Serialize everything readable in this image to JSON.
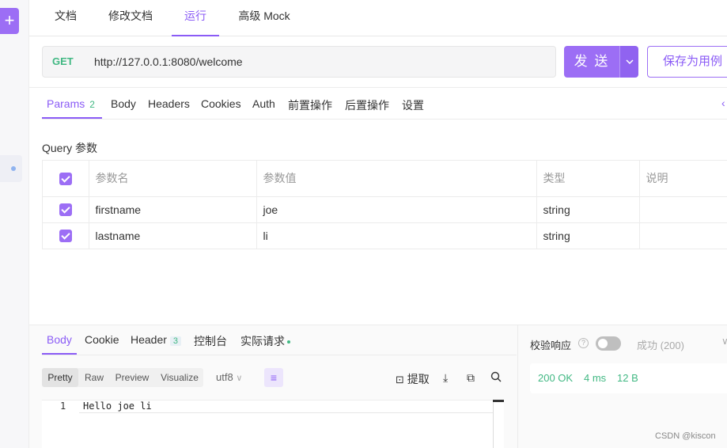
{
  "sidebar": {
    "add_icon": "+"
  },
  "top_tabs": [
    "文档",
    "修改文档",
    "运行",
    "高级 Mock"
  ],
  "request": {
    "method": "GET",
    "url": "http://127.0.0.1:8080/welcome",
    "send_label": "发 送",
    "save_label": "保存为用例"
  },
  "param_tabs": {
    "params_label": "Params",
    "params_count": "2",
    "items": [
      "Body",
      "Headers",
      "Cookies",
      "Auth",
      "前置操作",
      "后置操作",
      "设置"
    ]
  },
  "query": {
    "title": "Query 参数",
    "columns": [
      "参数名",
      "参数值",
      "类型",
      "说明"
    ],
    "rows": [
      {
        "name": "firstname",
        "value": "joe",
        "type": "string",
        "desc": ""
      },
      {
        "name": "lastname",
        "value": "li",
        "type": "string",
        "desc": ""
      }
    ]
  },
  "response": {
    "tabs": {
      "body": "Body",
      "cookie": "Cookie",
      "header": "Header",
      "header_count": "3",
      "console": "控制台",
      "actual": "实际请求"
    },
    "formats": [
      "Pretty",
      "Raw",
      "Preview",
      "Visualize"
    ],
    "encoding": "utf8",
    "extract_label": "提取",
    "code": {
      "line_number": "1",
      "text": "Hello joe li"
    },
    "verify_label": "校验响应",
    "success_option": "成功 (200)",
    "status_code": "200 OK",
    "time": "4 ms",
    "size": "12 B"
  },
  "watermark": "CSDN @kiscon",
  "colors": {
    "accent": "#9c6ef5",
    "success": "#41b883"
  }
}
